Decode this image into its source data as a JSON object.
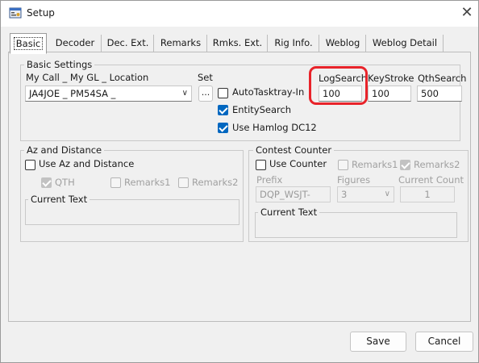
{
  "window": {
    "title": "Setup",
    "app_icon": "settings-window-icon",
    "close_icon": "close-icon"
  },
  "tabs": [
    {
      "label": "Basic",
      "active": true
    },
    {
      "label": "Decoder"
    },
    {
      "label": "Dec. Ext."
    },
    {
      "label": "Remarks"
    },
    {
      "label": "Rmks. Ext."
    },
    {
      "label": "Rig Info."
    },
    {
      "label": "Weblog"
    },
    {
      "label": "Weblog Detail"
    }
  ],
  "basic_settings": {
    "title": "Basic Settings",
    "location_label": "My Call _ My GL _ Location",
    "location_value": "JA4JOE _ PM54SA _",
    "set_label": "Set",
    "set_button": "...",
    "auto_tasktray": {
      "label": "AutoTasktray-In",
      "checked": false
    },
    "entity_search": {
      "label": "EntitySearch",
      "checked": true
    },
    "use_hamlog": {
      "label": "Use Hamlog DC12",
      "checked": true
    },
    "log_search": {
      "label": "LogSearch",
      "value": "100"
    },
    "key_stroke": {
      "label": "KeyStroke",
      "value": "100"
    },
    "qth_search": {
      "label": "QthSearch",
      "value": "500"
    }
  },
  "az_distance": {
    "title": "Az and Distance",
    "use_label": "Use Az and Distance",
    "use_checked": false,
    "qth_label": "QTH",
    "remarks1_label": "Remarks1",
    "remarks2_label": "Remarks2",
    "current_text_label": "Current Text"
  },
  "contest": {
    "title": "Contest Counter",
    "use_label": "Use Counter",
    "use_checked": false,
    "remarks1_label": "Remarks1",
    "remarks2_label": "Remarks2",
    "prefix_label": "Prefix",
    "prefix_value": "DQP_WSJT-",
    "figures_label": "Figures",
    "figures_value": "3",
    "current_count_label": "Current Count",
    "current_count_value": "1",
    "current_text_label": "Current Text"
  },
  "buttons": {
    "save": "Save",
    "cancel": "Cancel"
  },
  "colors": {
    "accent": "#0067c0",
    "highlight": "#e8232a"
  }
}
